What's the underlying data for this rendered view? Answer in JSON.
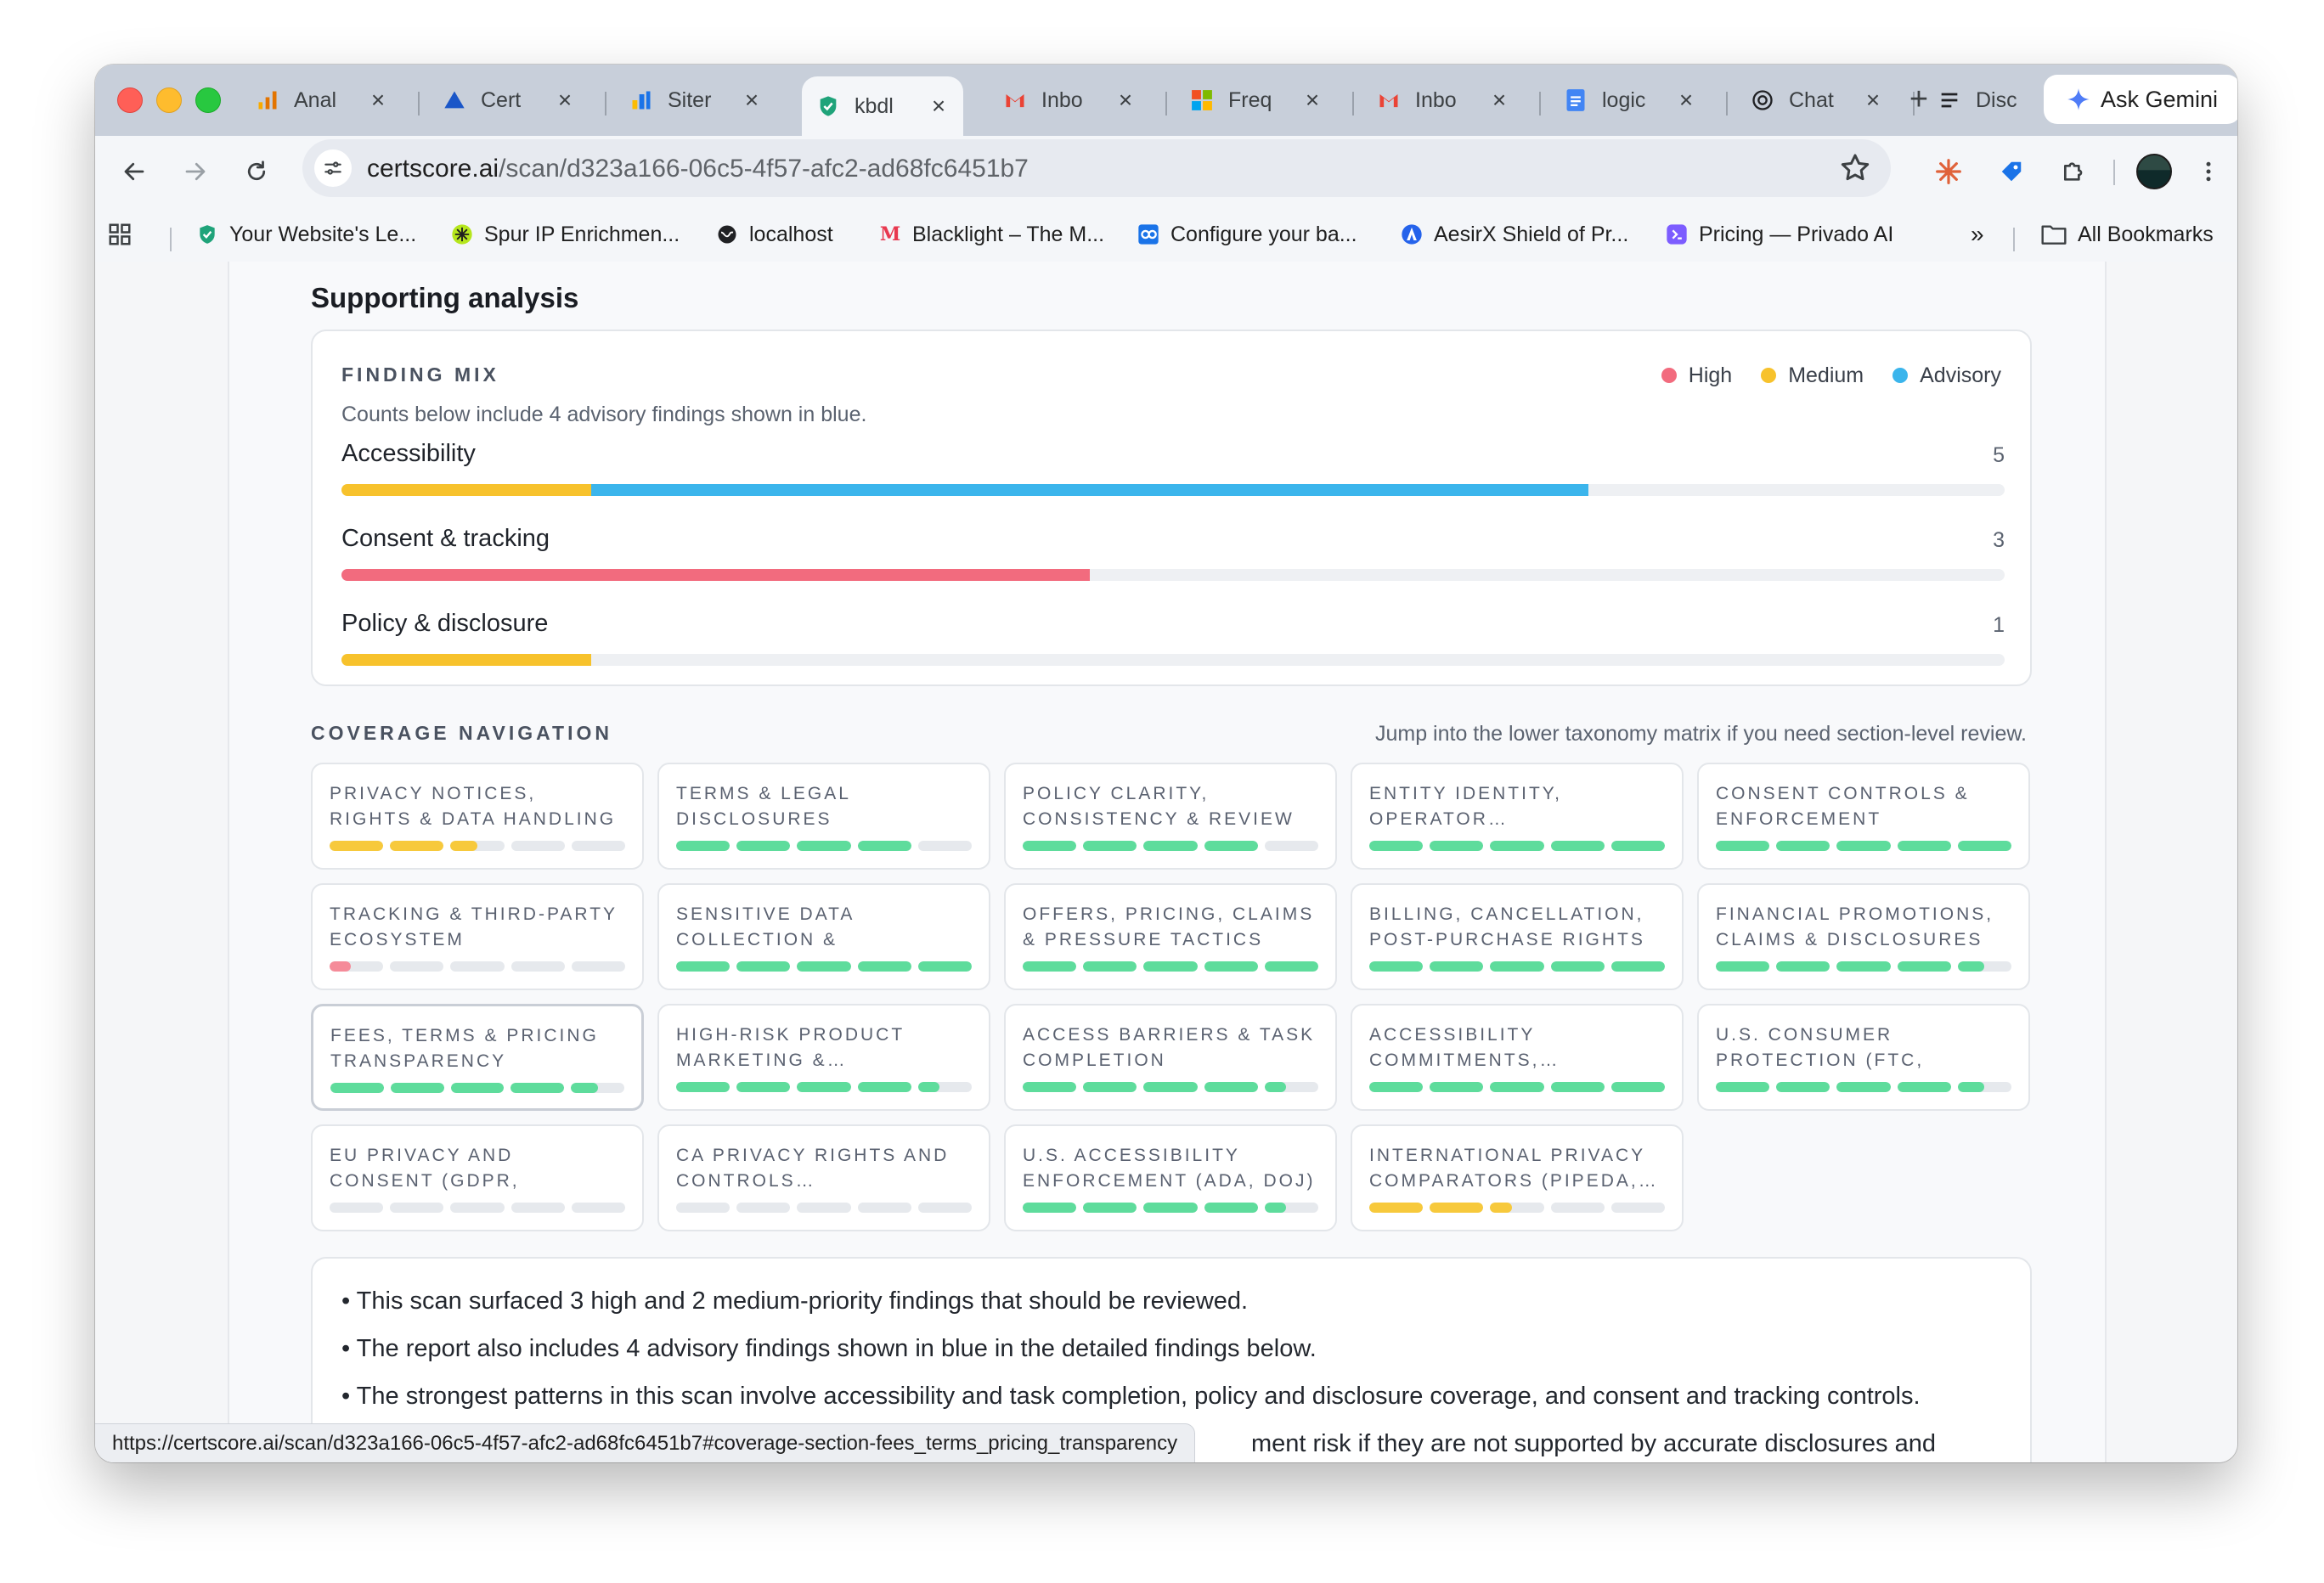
{
  "browser": {
    "tabs": [
      {
        "title": "Anal",
        "icon": "analytics-icon"
      },
      {
        "title": "Cert",
        "icon": "cert-icon"
      },
      {
        "title": "Siter",
        "icon": "sites-icon"
      },
      {
        "title": "kbdl",
        "icon": "shield-check-icon",
        "active": true
      },
      {
        "title": "Inbo",
        "icon": "gmail-icon"
      },
      {
        "title": "Freq",
        "icon": "microsoft-icon"
      },
      {
        "title": "Inbo",
        "icon": "gmail-icon"
      },
      {
        "title": "logic",
        "icon": "docs-icon"
      },
      {
        "title": "Chat",
        "icon": "chatgpt-icon"
      },
      {
        "title": "Disc",
        "icon": "list-icon"
      }
    ],
    "gemini_label": "Ask Gemini",
    "url_host": "certscore.ai",
    "url_path": "/scan/d323a166-06c5-4f57-afc2-ad68fc6451b7",
    "bookmarks": [
      {
        "label": "Your Website's Le...",
        "icon": "shield-check-icon",
        "color": "#1a73e8"
      },
      {
        "label": "Spur IP Enrichmen...",
        "icon": "spur-icon",
        "color": "#b5e61d"
      },
      {
        "label": "localhost",
        "icon": "globe-icon",
        "color": "#202124"
      },
      {
        "label": "Blacklight – The M...",
        "icon": "m-logo-icon",
        "color": "#e8384f"
      },
      {
        "label": "Configure your ba...",
        "icon": "config-icon",
        "color": "#1a73e8"
      },
      {
        "label": "AesirX Shield of Pr...",
        "icon": "aesirx-icon",
        "color": "#2563eb"
      },
      {
        "label": "Pricing — Privado AI",
        "icon": "privado-icon",
        "color": "#7c5cff"
      }
    ],
    "all_bookmarks_label": "All Bookmarks",
    "status_url": "https://certscore.ai/scan/d323a166-06c5-4f57-afc2-ad68fc6451b7#coverage-section-fees_terms_pricing_transparency"
  },
  "page": {
    "section_title": "Supporting analysis",
    "finding_mix": {
      "eyebrow": "FINDING MIX",
      "note": "Counts below include 4 advisory findings shown in blue.",
      "legend": [
        {
          "label": "High",
          "color": "#f26b7e"
        },
        {
          "label": "Medium",
          "color": "#f7c22c"
        },
        {
          "label": "Advisory",
          "color": "#3bb5ec"
        }
      ],
      "rows": [
        {
          "label": "Accessibility",
          "count": "5",
          "segments": [
            {
              "severity": "Medium",
              "count": 1
            },
            {
              "severity": "Advisory",
              "count": 4
            }
          ]
        },
        {
          "label": "Consent & tracking",
          "count": "3",
          "segments": [
            {
              "severity": "High",
              "count": 3
            }
          ]
        },
        {
          "label": "Policy & disclosure",
          "count": "1",
          "segments": [
            {
              "severity": "Medium",
              "count": 1
            }
          ]
        }
      ],
      "scale_max": 6.67
    },
    "coverage": {
      "eyebrow": "COVERAGE NAVIGATION",
      "hint": "Jump into the lower taxonomy matrix if you need section-level review.",
      "colors": {
        "green": "#5edc9c",
        "yellow": "#f7c93c",
        "red": "#f58b99"
      },
      "tiles": [
        {
          "label": "PRIVACY NOTICES, RIGHTS & DATA HANDLING",
          "color": "yellow",
          "level": 2.5
        },
        {
          "label": "TERMS & LEGAL DISCLOSURES",
          "color": "green",
          "level": 4
        },
        {
          "label": "POLICY CLARITY, CONSISTENCY & REVIEW",
          "color": "green",
          "level": 4
        },
        {
          "label": "ENTITY IDENTITY, OPERATOR…",
          "color": "green",
          "level": 5
        },
        {
          "label": "CONSENT CONTROLS & ENFORCEMENT",
          "color": "green",
          "level": 5
        },
        {
          "label": "TRACKING & THIRD-PARTY ECOSYSTEM",
          "color": "red",
          "level": 0.4
        },
        {
          "label": "SENSITIVE DATA COLLECTION & HANDLING…",
          "color": "green",
          "level": 5
        },
        {
          "label": "OFFERS, PRICING, CLAIMS & PRESSURE TACTICS",
          "color": "green",
          "level": 5
        },
        {
          "label": "BILLING, CANCELLATION, POST-PURCHASE RIGHTS …",
          "color": "green",
          "level": 5
        },
        {
          "label": "FINANCIAL PROMOTIONS, CLAIMS & DISCLOSURES",
          "color": "green",
          "level": 4.5
        },
        {
          "label": "FEES, TERMS & PRICING TRANSPARENCY",
          "color": "green",
          "level": 4.5,
          "focused": true
        },
        {
          "label": "HIGH-RISK PRODUCT MARKETING &…",
          "color": "green",
          "level": 4.4
        },
        {
          "label": "ACCESS BARRIERS & TASK COMPLETION",
          "color": "green",
          "level": 4.4
        },
        {
          "label": "ACCESSIBILITY COMMITMENTS,…",
          "color": "green",
          "level": 5
        },
        {
          "label": "U.S. CONSUMER PROTECTION (FTC, COPPA)",
          "color": "green",
          "level": 4.5
        },
        {
          "label": "EU PRIVACY AND CONSENT (GDPR, EPRIVACY, EDPB,…",
          "color": "green",
          "level": 0
        },
        {
          "label": "CA PRIVACY RIGHTS AND CONTROLS…",
          "color": "green",
          "level": 0
        },
        {
          "label": "U.S. ACCESSIBILITY ENFORCEMENT (ADA, DOJ)",
          "color": "green",
          "level": 4.4
        },
        {
          "label": "INTERNATIONAL PRIVACY COMPARATORS (PIPEDA,…",
          "color": "yellow",
          "level": 2.4
        }
      ]
    },
    "summary": [
      "• This scan surfaced 3 high and 2 medium-priority findings that should be reviewed.",
      "• The report also includes 4 advisory findings shown in blue in the detailed findings below.",
      "• The strongest patterns in this scan involve accessibility and task completion, policy and disclosure coverage, and consent and tracking controls.",
      "ment risk if they are not supported by accurate disclosures and"
    ]
  }
}
